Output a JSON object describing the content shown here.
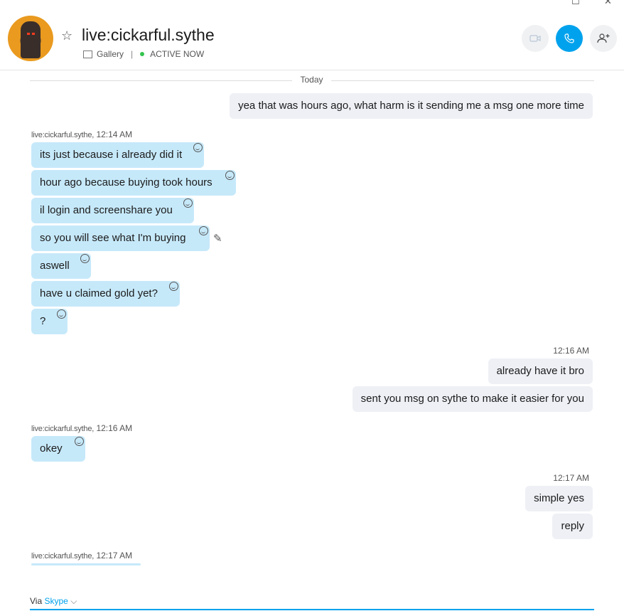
{
  "window": {
    "maximize_glyph": "☐",
    "close_glyph": "✕"
  },
  "header": {
    "contact_name": "live:cickarful.sythe",
    "gallery_label": "Gallery",
    "separator": "|",
    "status": "ACTIVE NOW",
    "status_color": "#33c44d",
    "accent": "#00a2ed"
  },
  "divider_label": "Today",
  "messages": {
    "m0": "yea that was hours ago, what harm is it sending me a msg one more time",
    "g1_sender": "live:cickarful.sythe,",
    "g1_time": "12:14 AM",
    "m1": "its just because i already did it",
    "m2": "hour ago because buying took hours",
    "m3": "il login and screenshare you",
    "m4": "so you will see what I'm buying",
    "m5": "aswell",
    "m6": "have u claimed gold yet?",
    "m7": "?",
    "g2_time": "12:16 AM",
    "m8": "already have it bro",
    "m9": "sent you msg on sythe to make it easier for you",
    "g3_sender": "live:cickarful.sythe,",
    "g3_time": "12:16 AM",
    "m10": "okey",
    "g4_time": "12:17 AM",
    "m11": "simple yes",
    "m12": "reply",
    "g5_sender": "live:cickarful.sythe,",
    "g5_time": "12:17 AM"
  },
  "composer": {
    "via": "Via",
    "service": "Skype",
    "chevron": "⌵"
  }
}
